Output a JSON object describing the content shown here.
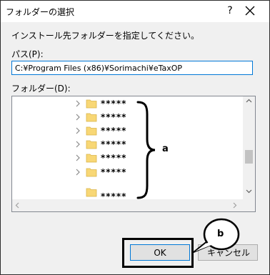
{
  "dialog": {
    "title": "フォルダーの選択",
    "help_label": "?",
    "instruction": "インストール先フォルダーを指定してください。",
    "path_label": "パス(P):",
    "path_value": "C:¥Program Files (x86)¥Sorimachi¥eTaxOP",
    "folder_label": "フォルダー(D):",
    "folders": [
      {
        "name": "*****"
      },
      {
        "name": "*****"
      },
      {
        "name": "*****"
      },
      {
        "name": "*****"
      },
      {
        "name": "*****"
      },
      {
        "name": "*****"
      },
      {
        "name": "*****"
      }
    ],
    "ok_label": "OK",
    "cancel_label": "キャンセル"
  },
  "annotations": {
    "callout_a": "a",
    "callout_b": "b"
  },
  "colors": {
    "accent": "#0078d7",
    "folder": "#f8d775"
  }
}
